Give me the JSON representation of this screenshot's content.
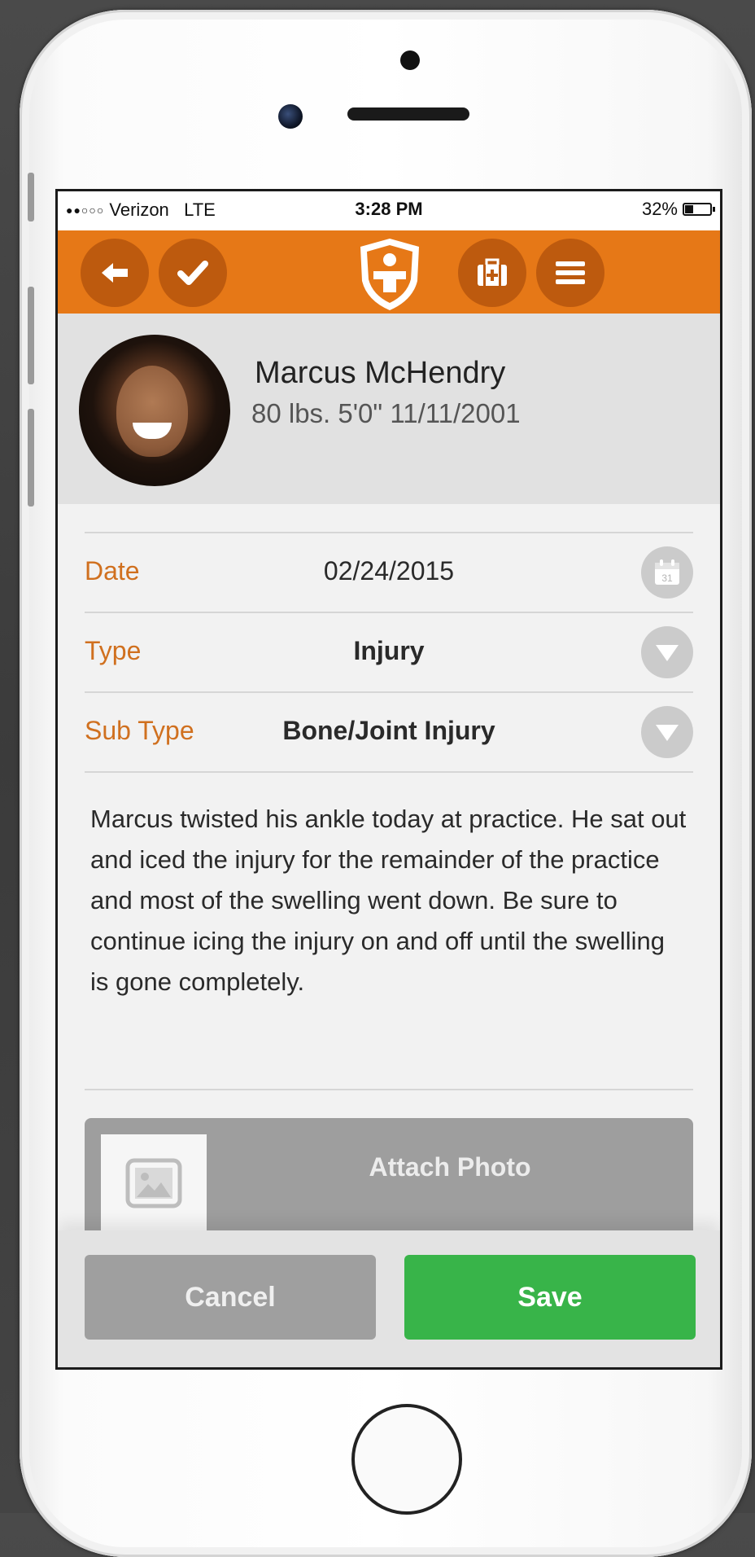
{
  "status_bar": {
    "carrier": "Verizon",
    "network": "LTE",
    "time": "3:28 PM",
    "battery": "32%"
  },
  "nav": {
    "back_icon": "back-arrow-icon",
    "check_icon": "checkmark-icon",
    "logo_icon": "medical-shield-logo-icon",
    "firstaid_icon": "first-aid-kit-icon",
    "menu_icon": "hamburger-menu-icon",
    "accent": "#e67817"
  },
  "profile": {
    "name": "Marcus McHendry",
    "weight": "80 lbs.",
    "height": "5'0\"",
    "dob": "11/11/2001"
  },
  "form": {
    "date": {
      "label": "Date",
      "value": "02/24/2015",
      "icon": "calendar-icon",
      "icon_text": "31"
    },
    "type": {
      "label": "Type",
      "value": "Injury",
      "icon": "dropdown-icon"
    },
    "sub_type": {
      "label": "Sub Type",
      "value": "Bone/Joint Injury",
      "icon": "dropdown-icon"
    }
  },
  "notes": "Marcus twisted his ankle today at practice. He sat out and iced the injury for the remainder of the practice and most of the swelling went down. Be sure to continue icing the injury on and off until the swelling is gone completely.",
  "attach": {
    "label": "Attach Photo",
    "icon": "image-placeholder-icon"
  },
  "buttons": {
    "cancel": "Cancel",
    "save": "Save",
    "save_color": "#38b449"
  }
}
